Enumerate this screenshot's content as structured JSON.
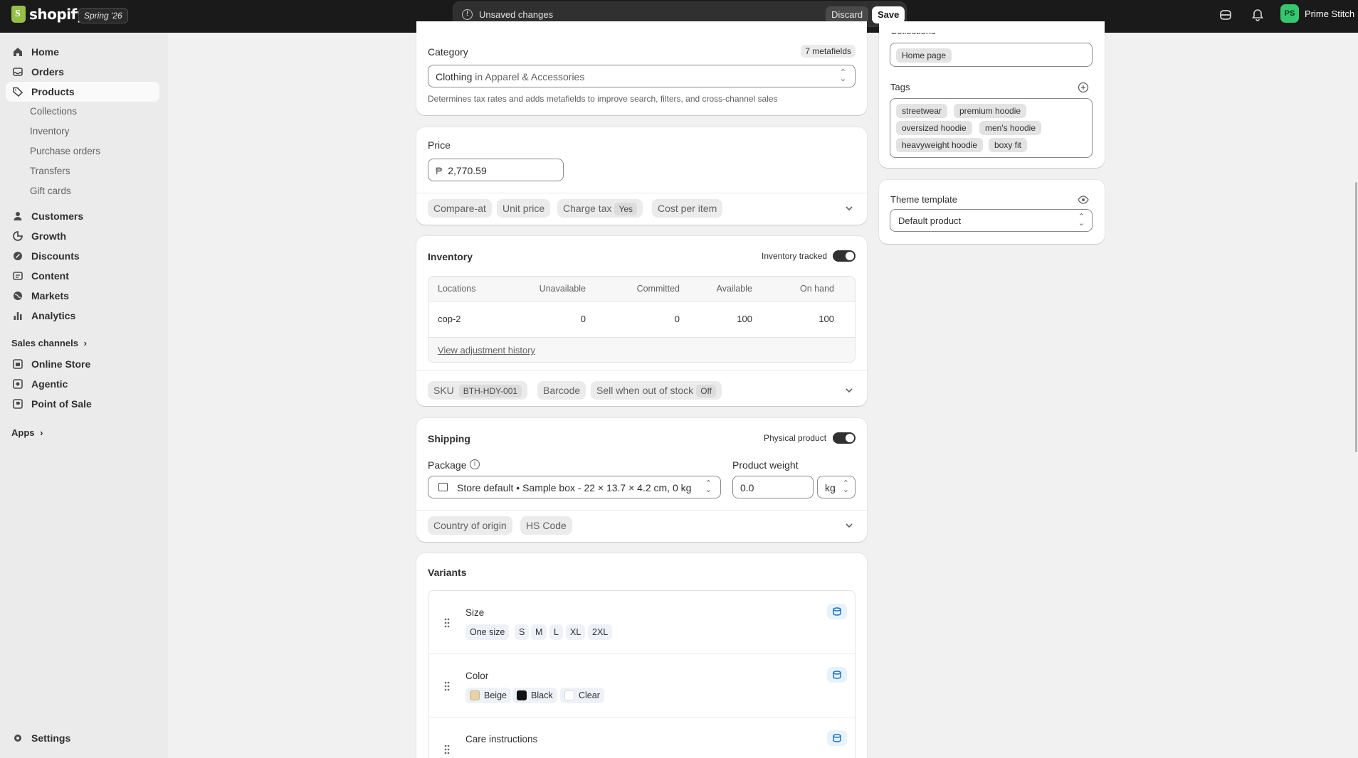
{
  "topbar": {
    "logo_text": "shopify",
    "edition": "Spring '26",
    "unsaved_message": "Unsaved changes",
    "discard_label": "Discard",
    "save_label": "Save",
    "user_initials": "PS",
    "user_name": "Prime Stitch"
  },
  "sidebar": {
    "home": "Home",
    "orders": "Orders",
    "products": "Products",
    "collections": "Collections",
    "inventory": "Inventory",
    "purchase_orders": "Purchase orders",
    "transfers": "Transfers",
    "gift_cards": "Gift cards",
    "customers": "Customers",
    "growth": "Growth",
    "discounts": "Discounts",
    "content": "Content",
    "markets": "Markets",
    "analytics": "Analytics",
    "sales_channels": "Sales channels",
    "online_store": "Online Store",
    "agentic": "Agentic",
    "point_of_sale": "Point of Sale",
    "apps": "Apps",
    "settings": "Settings"
  },
  "category": {
    "label": "Category",
    "metafields": "7 metafields",
    "value_main": "Clothing",
    "value_sub": "in Apparel & Accessories",
    "help": "Determines tax rates and adds metafields to improve search, filters, and cross-channel sales"
  },
  "price": {
    "label": "Price",
    "currency": "₱",
    "value": "2,770.59",
    "compare_at": "Compare-at",
    "unit_price": "Unit price",
    "charge_tax": "Charge tax",
    "charge_tax_value": "Yes",
    "cost_per_item": "Cost per item"
  },
  "inventory": {
    "title": "Inventory",
    "tracked_label": "Inventory tracked",
    "columns": [
      "Locations",
      "Unavailable",
      "Committed",
      "Available",
      "On hand"
    ],
    "row": [
      "cop-2",
      "0",
      "0",
      "100",
      "100"
    ],
    "history_link": "View adjustment history",
    "sku_label": "SKU",
    "sku_value": "BTH-HDY-001",
    "barcode": "Barcode",
    "sell_oos": "Sell when out of stock",
    "sell_oos_value": "Off"
  },
  "shipping": {
    "title": "Shipping",
    "physical_label": "Physical product",
    "package_label": "Package",
    "package_value": "Store default • Sample box - 22 × 13.7 × 4.2 cm, 0 kg",
    "weight_label": "Product weight",
    "weight_value": "0.0",
    "weight_unit": "kg",
    "country_of_origin": "Country of origin",
    "hs_code": "HS Code"
  },
  "variants": {
    "title": "Variants",
    "options": [
      {
        "name": "Size",
        "values": [
          "One size",
          "S",
          "M",
          "L",
          "XL",
          "2XL"
        ]
      },
      {
        "name": "Color",
        "values": [
          "Beige",
          "Black",
          "Clear"
        ],
        "swatches": [
          "#e8d3a8",
          "#111111",
          "#ffffff"
        ]
      },
      {
        "name": "Care instructions"
      }
    ]
  },
  "right": {
    "collections_label": "Collections",
    "collection_tag": "Home page",
    "tags_label": "Tags",
    "tags": [
      "streetwear",
      "premium hoodie",
      "oversized hoodie",
      "men's hoodie",
      "heavyweight hoodie",
      "boxy fit"
    ],
    "theme_label": "Theme template",
    "theme_value": "Default product"
  }
}
